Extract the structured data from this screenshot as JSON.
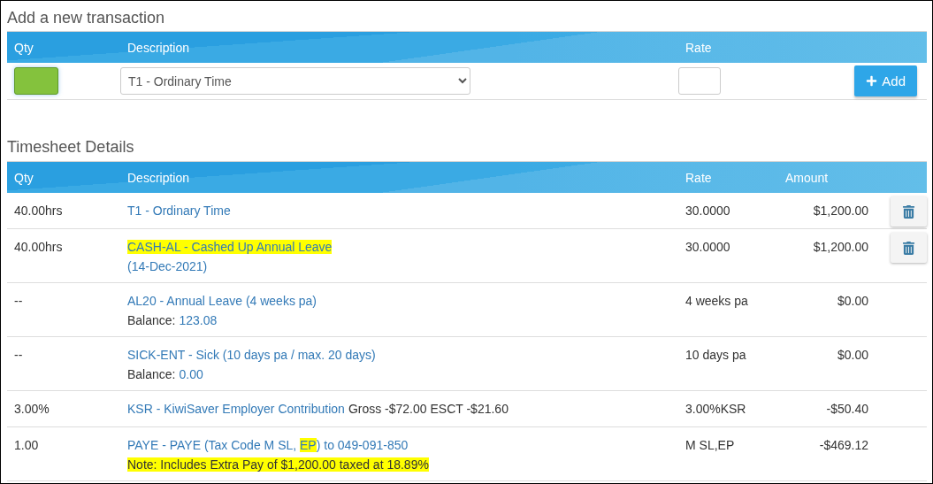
{
  "add_section": {
    "title": "Add a new transaction",
    "columns": [
      "Qty",
      "Description",
      "Rate"
    ],
    "description_select": {
      "value": "T1 - Ordinary Time"
    },
    "add_button": {
      "label": "Add"
    }
  },
  "timesheet": {
    "title": "Timesheet Details",
    "columns": [
      "Qty",
      "Description",
      "Rate",
      "Amount"
    ],
    "rows": [
      {
        "qty": "40.00hrs",
        "lines": [
          [
            {
              "kind": "link",
              "parts": [
                {
                  "text": "T1 - Ordinary Time",
                  "highlighted": false
                }
              ]
            }
          ]
        ],
        "rate": "30.0000",
        "amount": "$1,200.00",
        "deletable": true
      },
      {
        "qty": "40.00hrs",
        "lines": [
          [
            {
              "kind": "link",
              "parts": [
                {
                  "text": "CASH-AL - Cashed Up Annual Leave",
                  "highlighted": true
                }
              ]
            }
          ],
          [
            {
              "kind": "link",
              "parts": [
                {
                  "text": "(14-Dec-2021)",
                  "highlighted": false
                }
              ]
            }
          ]
        ],
        "rate": "30.0000",
        "amount": "$1,200.00",
        "deletable": true
      },
      {
        "qty": "--",
        "lines": [
          [
            {
              "kind": "link",
              "parts": [
                {
                  "text": "AL20 - Annual Leave (4 weeks pa)",
                  "highlighted": false
                }
              ]
            }
          ],
          [
            {
              "kind": "plain",
              "parts": [
                {
                  "text": "Balance:",
                  "highlighted": false
                }
              ]
            },
            {
              "kind": "link",
              "parts": [
                {
                  "text": "123.08",
                  "highlighted": false
                }
              ]
            }
          ]
        ],
        "rate": "4 weeks pa",
        "amount": "$0.00",
        "deletable": false
      },
      {
        "qty": "--",
        "lines": [
          [
            {
              "kind": "link",
              "parts": [
                {
                  "text": "SICK-ENT - Sick (10 days pa / max. 20 days)",
                  "highlighted": false
                }
              ]
            }
          ],
          [
            {
              "kind": "plain",
              "parts": [
                {
                  "text": "Balance:",
                  "highlighted": false
                }
              ]
            },
            {
              "kind": "link",
              "parts": [
                {
                  "text": "0.00",
                  "highlighted": false
                }
              ]
            }
          ]
        ],
        "rate": "10 days pa",
        "amount": "$0.00",
        "deletable": false
      },
      {
        "qty": "3.00%",
        "lines": [
          [
            {
              "kind": "link",
              "parts": [
                {
                  "text": "KSR - KiwiSaver Employer Contribution",
                  "highlighted": false
                }
              ]
            },
            {
              "kind": "plain",
              "parts": [
                {
                  "text": "Gross -$72.00 ESCT -$21.60",
                  "highlighted": false
                }
              ]
            }
          ]
        ],
        "rate": "3.00%KSR",
        "amount": "-$50.40",
        "deletable": false
      },
      {
        "qty": "1.00",
        "lines": [
          [
            {
              "kind": "link",
              "parts": [
                {
                  "text": "PAYE - PAYE (Tax Code M SL, ",
                  "highlighted": false
                },
                {
                  "text": "EP",
                  "highlighted": true
                },
                {
                  "text": ") to 049-091-850",
                  "highlighted": false
                }
              ]
            }
          ],
          [
            {
              "kind": "plain",
              "parts": [
                {
                  "text": "Note: Includes Extra Pay of $1,200.00 taxed at 18.89%",
                  "highlighted": true
                }
              ]
            }
          ]
        ],
        "rate": "M SL,EP",
        "amount": "-$469.12",
        "deletable": false
      }
    ]
  }
}
